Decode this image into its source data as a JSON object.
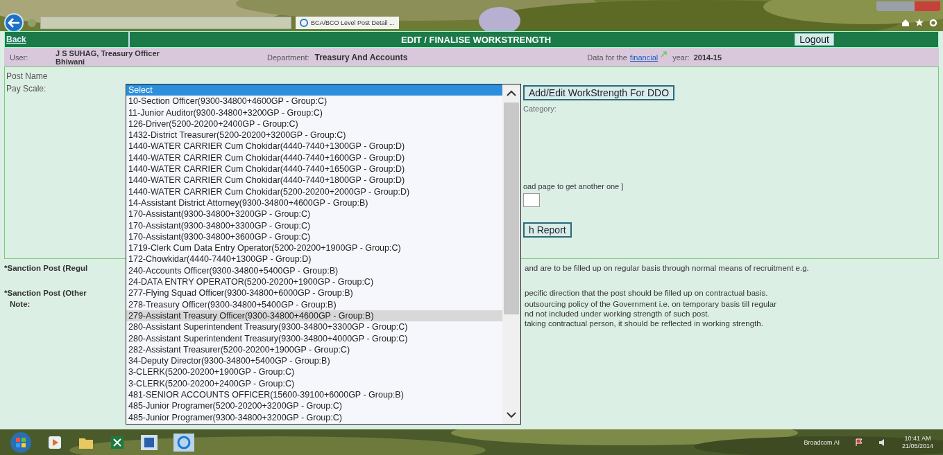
{
  "browser": {
    "tab_title": "BCA/BCO Level Post Detail ..."
  },
  "header": {
    "back": "Back",
    "title": "EDIT / FINALISE WORKSTRENGTH",
    "logout": "Logout"
  },
  "user_row": {
    "user_label": "User:",
    "user_name": "J S SUHAG, Treasury Officer Bhiwani",
    "department_label": "Department:",
    "department": "Treasury And Accounts",
    "data_for": "Data for the",
    "financial_link": "financial",
    "year_label": "year:",
    "year": "2014-15"
  },
  "form": {
    "post_name_label": "Post Name",
    "pay_scale_label": "Pay Scale:",
    "add_edit_button": "Add/Edit WorkStrength For DDO",
    "category_label": "Category:",
    "reload_hint": "oad page to get another one ]",
    "report_button": "h Report"
  },
  "notes": {
    "regular_label": "*Sanction Post (Regul",
    "regular_text": "and are to be filled up on regular basis through normal means of recruitment e.g.",
    "other_label": "*Sanction Post (Other",
    "other_text": "pecific direction that the post should be filled up on contractual basis.",
    "note_label": "Note:",
    "note_lines": [
      "outsourcing policy of the Government i.e. on temporary basis till regular",
      "nd not included under working strength of such post.",
      "taking contractual person, it should be reflected in working strength."
    ]
  },
  "dropdown": {
    "options": [
      {
        "label": "Select",
        "selected": true,
        "hovered": false
      },
      {
        "label": "10-Section Officer(9300-34800+4600GP - Group:C)",
        "selected": false,
        "hovered": false
      },
      {
        "label": "11-Junior Auditor(9300-34800+3200GP - Group:C)",
        "selected": false,
        "hovered": false
      },
      {
        "label": "126-Driver(5200-20200+2400GP - Group:C)",
        "selected": false,
        "hovered": false
      },
      {
        "label": "1432-District Treasurer(5200-20200+3200GP - Group:C)",
        "selected": false,
        "hovered": false
      },
      {
        "label": "1440-WATER CARRIER Cum Chokidar(4440-7440+1300GP - Group:D)",
        "selected": false,
        "hovered": false
      },
      {
        "label": "1440-WATER CARRIER Cum Chokidar(4440-7440+1600GP - Group:D)",
        "selected": false,
        "hovered": false
      },
      {
        "label": "1440-WATER CARRIER Cum Chokidar(4440-7440+1650GP - Group:D)",
        "selected": false,
        "hovered": false
      },
      {
        "label": "1440-WATER CARRIER Cum Chokidar(4440-7440+1800GP - Group:D)",
        "selected": false,
        "hovered": false
      },
      {
        "label": "1440-WATER CARRIER Cum Chokidar(5200-20200+2000GP - Group:D)",
        "selected": false,
        "hovered": false
      },
      {
        "label": "14-Assistant District Attorney(9300-34800+4600GP - Group:B)",
        "selected": false,
        "hovered": false
      },
      {
        "label": "170-Assistant(9300-34800+3200GP - Group:C)",
        "selected": false,
        "hovered": false
      },
      {
        "label": "170-Assistant(9300-34800+3300GP - Group:C)",
        "selected": false,
        "hovered": false
      },
      {
        "label": "170-Assistant(9300-34800+3600GP - Group:C)",
        "selected": false,
        "hovered": false
      },
      {
        "label": "1719-Clerk Cum Data Entry Operator(5200-20200+1900GP - Group:C)",
        "selected": false,
        "hovered": false
      },
      {
        "label": "172-Chowkidar(4440-7440+1300GP - Group:D)",
        "selected": false,
        "hovered": false
      },
      {
        "label": "240-Accounts Officer(9300-34800+5400GP - Group:B)",
        "selected": false,
        "hovered": false
      },
      {
        "label": "24-DATA ENTRY OPERATOR(5200-20200+1900GP - Group:C)",
        "selected": false,
        "hovered": false
      },
      {
        "label": "277-Flying Squad Officer(9300-34800+6000GP - Group:B)",
        "selected": false,
        "hovered": false
      },
      {
        "label": "278-Treasury Officer(9300-34800+5400GP - Group:B)",
        "selected": false,
        "hovered": false
      },
      {
        "label": "279-Assistant Treasury Officer(9300-34800+4600GP - Group:B)",
        "selected": false,
        "hovered": true
      },
      {
        "label": "280-Assistant Superintendent Treasury(9300-34800+3300GP - Group:C)",
        "selected": false,
        "hovered": false
      },
      {
        "label": "280-Assistant Superintendent Treasury(9300-34800+4000GP - Group:C)",
        "selected": false,
        "hovered": false
      },
      {
        "label": "282-Assistant Treasurer(5200-20200+1900GP - Group:C)",
        "selected": false,
        "hovered": false
      },
      {
        "label": "34-Deputy Director(9300-34800+5400GP - Group:B)",
        "selected": false,
        "hovered": false
      },
      {
        "label": "3-CLERK(5200-20200+1900GP - Group:C)",
        "selected": false,
        "hovered": false
      },
      {
        "label": "3-CLERK(5200-20200+2400GP - Group:C)",
        "selected": false,
        "hovered": false
      },
      {
        "label": "481-SENIOR ACCOUNTS OFFICER(15600-39100+6000GP - Group:B)",
        "selected": false,
        "hovered": false
      },
      {
        "label": "485-Junior Programer(5200-20200+3200GP - Group:C)",
        "selected": false,
        "hovered": false
      },
      {
        "label": "485-Junior Programer(9300-34800+3200GP - Group:C)",
        "selected": false,
        "hovered": false
      }
    ]
  },
  "taskbar": {
    "network": "Broadcom AI",
    "time": "10:41 AM",
    "date": "21/05/2014"
  }
}
